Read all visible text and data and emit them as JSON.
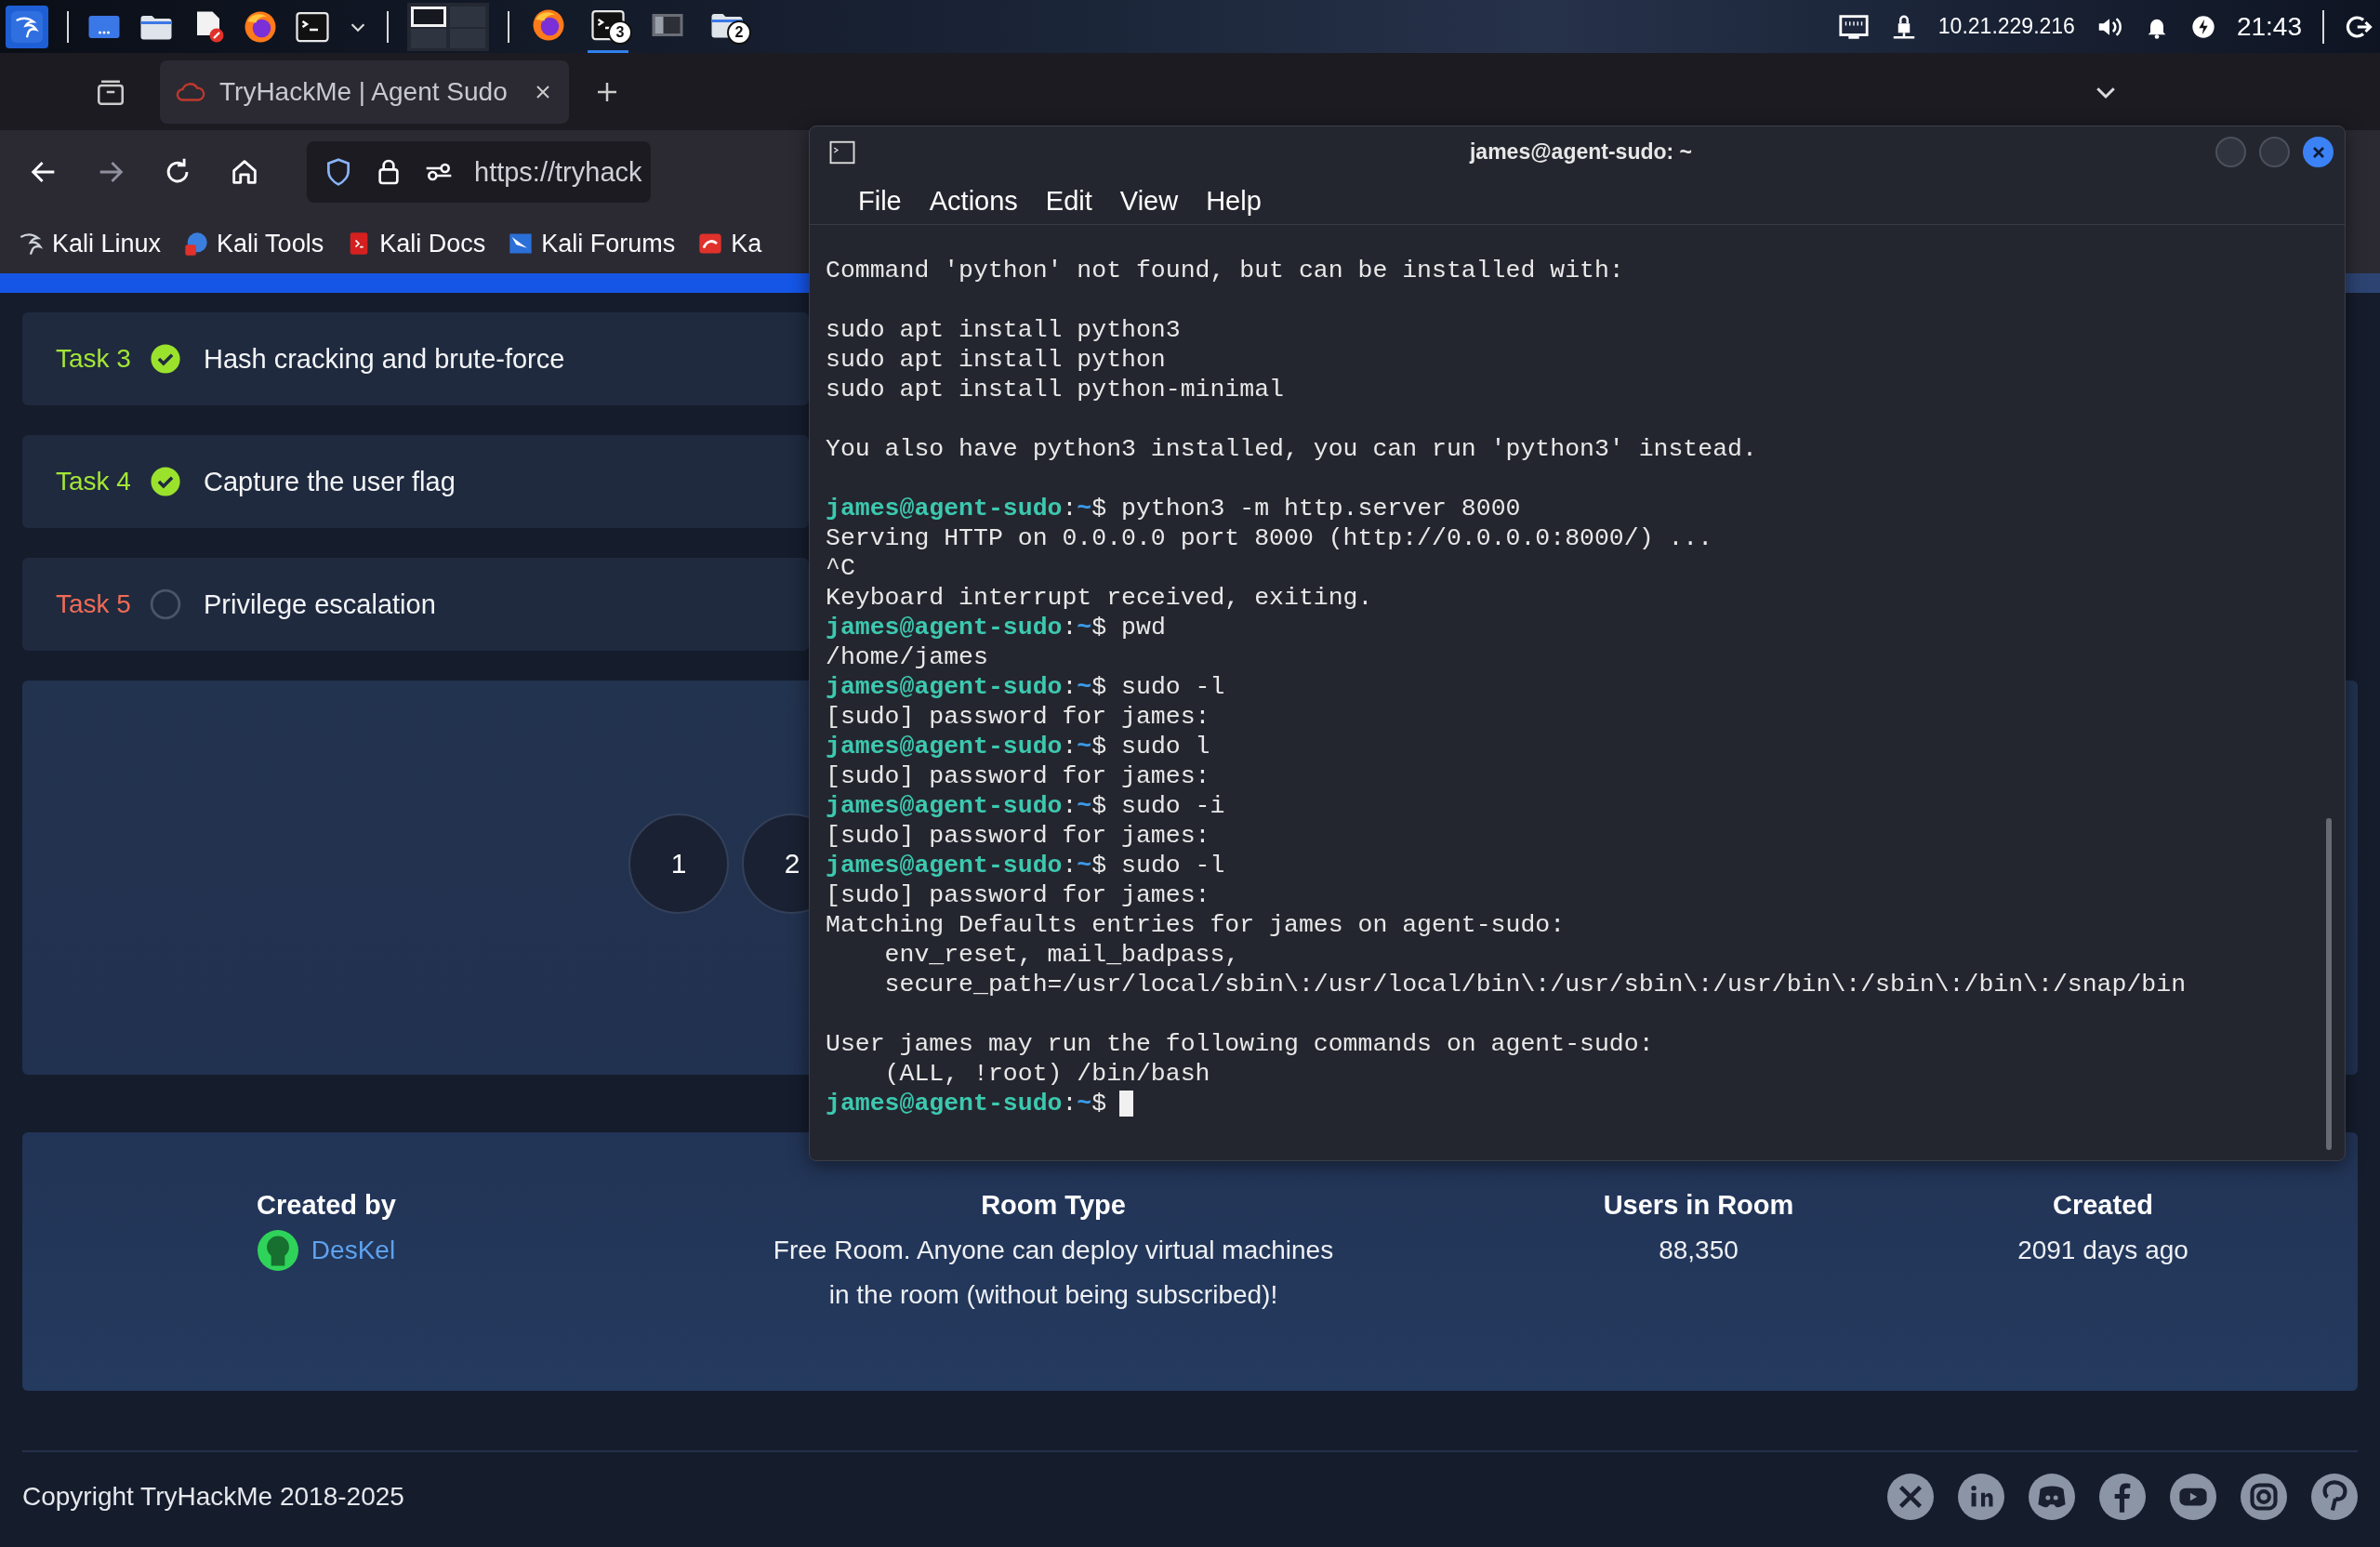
{
  "panel": {
    "taskbar": [
      {
        "kind": "firefox",
        "active": false
      },
      {
        "kind": "terminal",
        "badge": "3",
        "active": true
      },
      {
        "kind": "window",
        "active": false
      },
      {
        "kind": "folder",
        "badge": "2",
        "active": false
      }
    ],
    "ip": "10.21.229.216",
    "clock": "21:43"
  },
  "browser": {
    "tabs": [
      {
        "title": "TryHackMe | Agent Sudo",
        "selected": true
      }
    ],
    "url": "https://tryhack",
    "bookmarks": [
      {
        "label": "Kali Linux"
      },
      {
        "label": "Kali Tools"
      },
      {
        "label": "Kali Docs"
      },
      {
        "label": "Kali Forums"
      },
      {
        "label": "Ka"
      }
    ]
  },
  "tasks": [
    {
      "label": "Task 3",
      "title": "Hash cracking and brute-force",
      "done": true
    },
    {
      "label": "Task 4",
      "title": "Capture the user flag",
      "done": true
    },
    {
      "label": "Task 5",
      "title": "Privilege escalation",
      "done": false
    }
  ],
  "rating": {
    "options": [
      "1",
      "2"
    ]
  },
  "room_info": [
    {
      "kind": "author",
      "heading": "Created by",
      "value": "DesKel"
    },
    {
      "kind": "text",
      "heading": "Room Type",
      "value": "Free Room. Anyone can deploy virtual machines\nin the room (without being subscribed)!"
    },
    {
      "kind": "text",
      "heading": "Users in Room",
      "value": "88,350"
    },
    {
      "kind": "text",
      "heading": "Created",
      "value": "2091 days ago"
    }
  ],
  "footer": {
    "copyright": "Copyright TryHackMe 2018-2025",
    "social": [
      {
        "kind": "x"
      },
      {
        "kind": "linkedin"
      },
      {
        "kind": "discord"
      },
      {
        "kind": "facebook"
      },
      {
        "kind": "youtube"
      },
      {
        "kind": "instagram"
      },
      {
        "kind": "pinterest"
      }
    ]
  },
  "terminal": {
    "title": "james@agent-sudo: ~",
    "menu": [
      "File",
      "Actions",
      "Edit",
      "View",
      "Help"
    ],
    "lines": [
      {
        "kind": "output",
        "text": "Command 'python' not found, but can be installed with:"
      },
      {
        "kind": "blank"
      },
      {
        "kind": "output",
        "text": "sudo apt install python3"
      },
      {
        "kind": "output",
        "text": "sudo apt install python"
      },
      {
        "kind": "output",
        "text": "sudo apt install python-minimal"
      },
      {
        "kind": "blank"
      },
      {
        "kind": "output",
        "text": "You also have python3 installed, you can run 'python3' instead."
      },
      {
        "kind": "blank"
      },
      {
        "kind": "prompt",
        "user": "james@agent-sudo",
        "sep": ":",
        "cwd": "~",
        "sign": "$",
        "command": "python3 -m http.server 8000"
      },
      {
        "kind": "output",
        "text": "Serving HTTP on 0.0.0.0 port 8000 (http://0.0.0.0:8000/) ..."
      },
      {
        "kind": "output",
        "text": "^C"
      },
      {
        "kind": "output",
        "text": "Keyboard interrupt received, exiting."
      },
      {
        "kind": "prompt",
        "user": "james@agent-sudo",
        "sep": ":",
        "cwd": "~",
        "sign": "$",
        "command": "pwd"
      },
      {
        "kind": "output",
        "text": "/home/james"
      },
      {
        "kind": "prompt",
        "user": "james@agent-sudo",
        "sep": ":",
        "cwd": "~",
        "sign": "$",
        "command": "sudo -l"
      },
      {
        "kind": "output",
        "text": "[sudo] password for james:"
      },
      {
        "kind": "prompt",
        "user": "james@agent-sudo",
        "sep": ":",
        "cwd": "~",
        "sign": "$",
        "command": "sudo l"
      },
      {
        "kind": "output",
        "text": "[sudo] password for james:"
      },
      {
        "kind": "prompt",
        "user": "james@agent-sudo",
        "sep": ":",
        "cwd": "~",
        "sign": "$",
        "command": "sudo -i"
      },
      {
        "kind": "output",
        "text": "[sudo] password for james:"
      },
      {
        "kind": "prompt",
        "user": "james@agent-sudo",
        "sep": ":",
        "cwd": "~",
        "sign": "$",
        "command": "sudo -l"
      },
      {
        "kind": "output",
        "text": "[sudo] password for james:"
      },
      {
        "kind": "output",
        "text": "Matching Defaults entries for james on agent-sudo:"
      },
      {
        "kind": "output",
        "text": "    env_reset, mail_badpass,"
      },
      {
        "kind": "output",
        "text": "    secure_path=/usr/local/sbin\\:/usr/local/bin\\:/usr/sbin\\:/usr/bin\\:/sbin\\:/bin\\:/snap/bin"
      },
      {
        "kind": "blank"
      },
      {
        "kind": "output",
        "text": "User james may run the following commands on agent-sudo:"
      },
      {
        "kind": "output",
        "text": "    (ALL, !root) /bin/bash"
      },
      {
        "kind": "prompt",
        "user": "james@agent-sudo",
        "sep": ":",
        "cwd": "~",
        "sign": "$",
        "cursor": true
      }
    ]
  }
}
